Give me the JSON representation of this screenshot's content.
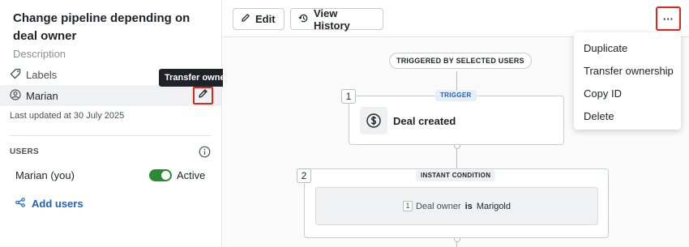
{
  "sidebar": {
    "title": "Change pipeline depending on deal owner",
    "description": "Description",
    "labels": "Labels",
    "owner": "Marian",
    "tooltip": "Transfer ownership",
    "last_updated": "Last updated at 30 July 2025",
    "users_heading": "USERS",
    "user_name": "Marian (you)",
    "user_status": "Active",
    "add_users": "Add users"
  },
  "toolbar": {
    "edit": "Edit",
    "view_history": "View History",
    "more": "···"
  },
  "menu": {
    "items": [
      "Duplicate",
      "Transfer ownership",
      "Copy ID",
      "Delete"
    ]
  },
  "canvas": {
    "scope_pill": "TRIGGERED BY SELECTED USERS",
    "step1": {
      "number": "1",
      "tag": "TRIGGER",
      "title": "Deal created"
    },
    "step2": {
      "number": "2",
      "tag": "INSTANT CONDITION",
      "condition": {
        "index": "1",
        "field": "Deal owner",
        "operator": "is",
        "value": "Marigold"
      }
    }
  },
  "colors": {
    "accent": "#1a63c9",
    "toggle_on": "#2c8a36",
    "highlight": "#e0261b"
  }
}
